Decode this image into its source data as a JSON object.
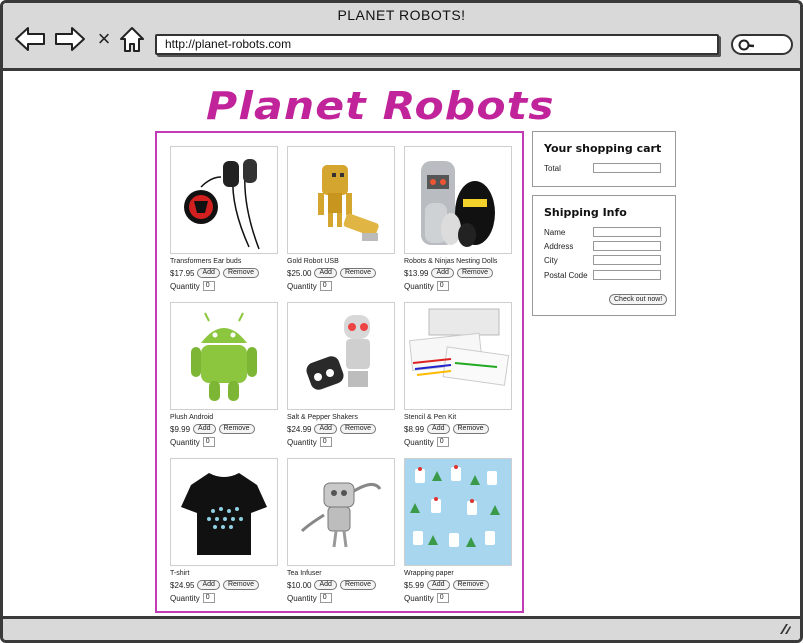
{
  "browser": {
    "title": "PLANET ROBOTS!",
    "url": "http://planet-robots.com",
    "stop_glyph": "×"
  },
  "site": {
    "logo": "Planet Robots"
  },
  "labels": {
    "add": "Add",
    "remove": "Remove",
    "quantity": "Quantity"
  },
  "products": [
    {
      "name": "Transformers Ear buds",
      "price": "$17.95",
      "qty": "0"
    },
    {
      "name": "Gold Robot USB",
      "price": "$25.00",
      "qty": "0"
    },
    {
      "name": "Robots & Ninjas Nesting Dolls",
      "price": "$13.99",
      "qty": "0"
    },
    {
      "name": "Plush Android",
      "price": "$9.99",
      "qty": "0"
    },
    {
      "name": "Salt & Pepper Shakers",
      "price": "$24.99",
      "qty": "0"
    },
    {
      "name": "Stencil & Pen Kit",
      "price": "$8.99",
      "qty": "0"
    },
    {
      "name": "T-shirt",
      "price": "$24.95",
      "qty": "0"
    },
    {
      "name": "Tea Infuser",
      "price": "$10.00",
      "qty": "0"
    },
    {
      "name": "Wrapping paper",
      "price": "$5.99",
      "qty": "0"
    }
  ],
  "cart": {
    "title": "Your shopping cart",
    "total_label": "Total"
  },
  "shipping": {
    "title": "Shipping Info",
    "name_label": "Name",
    "address_label": "Address",
    "city_label": "City",
    "postal_label": "Postal Code",
    "checkout_label": "Check out now!"
  },
  "colors": {
    "accent": "#c0239a",
    "border": "#c43bb6"
  }
}
